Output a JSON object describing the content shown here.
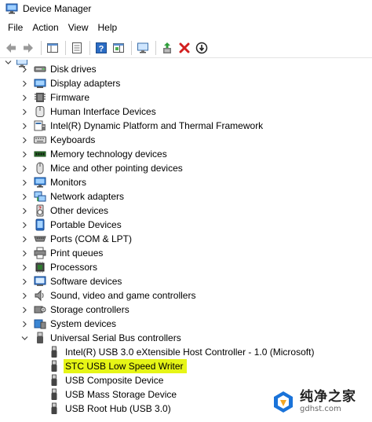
{
  "window": {
    "title": "Device Manager"
  },
  "menu": [
    "File",
    "Action",
    "View",
    "Help"
  ],
  "toolbar": {
    "buttons": [
      "back-icon",
      "forward-icon",
      "show-hide-console-tree-icon",
      "properties-icon",
      "help-icon",
      "action-pane-icon",
      "monitor-icon",
      "update-driver-icon",
      "uninstall-icon",
      "disable-device-icon"
    ]
  },
  "tree": {
    "categories": [
      {
        "label": "Disk drives",
        "icon": "disk-drive-icon"
      },
      {
        "label": "Display adapters",
        "icon": "display-adapter-icon"
      },
      {
        "label": "Firmware",
        "icon": "firmware-icon"
      },
      {
        "label": "Human Interface Devices",
        "icon": "hid-icon"
      },
      {
        "label": "Intel(R) Dynamic Platform and Thermal Framework",
        "icon": "intel-dptf-icon"
      },
      {
        "label": "Keyboards",
        "icon": "keyboard-icon"
      },
      {
        "label": "Memory technology devices",
        "icon": "memory-icon"
      },
      {
        "label": "Mice and other pointing devices",
        "icon": "mouse-icon"
      },
      {
        "label": "Monitors",
        "icon": "monitor-icon"
      },
      {
        "label": "Network adapters",
        "icon": "network-adapter-icon"
      },
      {
        "label": "Other devices",
        "icon": "other-devices-icon"
      },
      {
        "label": "Portable Devices",
        "icon": "portable-device-icon"
      },
      {
        "label": "Ports (COM & LPT)",
        "icon": "port-icon"
      },
      {
        "label": "Print queues",
        "icon": "printer-icon"
      },
      {
        "label": "Processors",
        "icon": "processor-icon"
      },
      {
        "label": "Software devices",
        "icon": "software-device-icon"
      },
      {
        "label": "Sound, video and game controllers",
        "icon": "speaker-icon"
      },
      {
        "label": "Storage controllers",
        "icon": "storage-controller-icon"
      },
      {
        "label": "System devices",
        "icon": "system-device-icon"
      },
      {
        "label": "Universal Serial Bus controllers",
        "icon": "usb-icon",
        "expanded": true
      }
    ],
    "usb_children": [
      {
        "label": "Intel(R) USB 3.0 eXtensible Host Controller - 1.0 (Microsoft)",
        "highlighted": false
      },
      {
        "label": "STC USB Low Speed Writer",
        "highlighted": true
      },
      {
        "label": "USB Composite Device",
        "highlighted": false
      },
      {
        "label": "USB Mass Storage Device",
        "highlighted": false
      },
      {
        "label": "USB Root Hub (USB 3.0)",
        "highlighted": false
      }
    ]
  },
  "watermark": {
    "title": "纯净之家",
    "subtitle": "gdhst.com"
  },
  "colors": {
    "highlight": "#e6f516",
    "accent": "#0a64c8"
  }
}
